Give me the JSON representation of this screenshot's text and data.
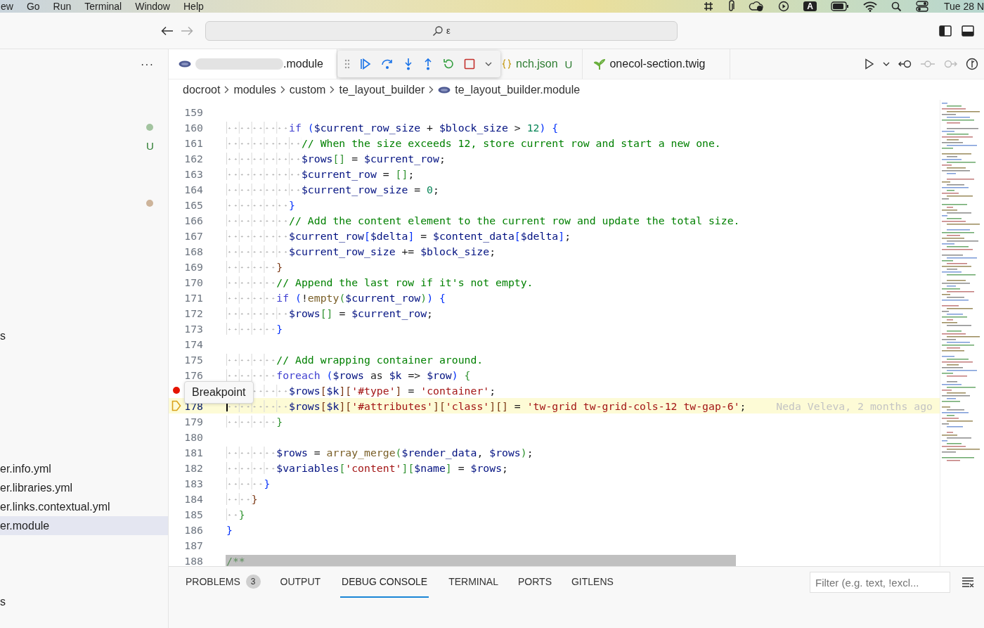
{
  "menu_bar": {
    "items": [
      "ew",
      "Go",
      "Run",
      "Terminal",
      "Window",
      "Help"
    ],
    "input_source": "A",
    "clock": "Tue 28 N"
  },
  "title_bar": {
    "search_text": "ε"
  },
  "sidebar": {
    "more": "···",
    "items": [
      {
        "kind": "blank"
      },
      {
        "kind": "blank"
      },
      {
        "kind": "dot",
        "color": "#a3c4a0"
      },
      {
        "kind": "badge",
        "badge": "U"
      },
      {
        "kind": "blank"
      },
      {
        "kind": "blank"
      },
      {
        "kind": "dot",
        "color": "#cdb49a"
      },
      {
        "kind": "blank"
      },
      {
        "kind": "blank"
      },
      {
        "kind": "blank"
      },
      {
        "kind": "blank"
      },
      {
        "kind": "blank"
      },
      {
        "kind": "blank"
      },
      {
        "kind": "file",
        "label": "s",
        "selected": false
      },
      {
        "kind": "blank"
      },
      {
        "kind": "blank"
      },
      {
        "kind": "blank"
      },
      {
        "kind": "blank"
      },
      {
        "kind": "blank"
      },
      {
        "kind": "blank"
      },
      {
        "kind": "file",
        "label": "er.info.yml",
        "selected": false
      },
      {
        "kind": "file",
        "label": "er.libraries.yml",
        "selected": false
      },
      {
        "kind": "file",
        "label": "er.links.contextual.yml",
        "selected": false
      },
      {
        "kind": "file",
        "label": "er.module",
        "selected": true
      },
      {
        "kind": "blank"
      },
      {
        "kind": "blank"
      },
      {
        "kind": "blank"
      },
      {
        "kind": "file",
        "label": "s",
        "selected": false
      }
    ]
  },
  "tabs": [
    {
      "kind": "php",
      "label": ".module",
      "selected": true,
      "redacted": true
    },
    {
      "kind": "json",
      "label": "nch.json",
      "badge": "U",
      "selected": false,
      "redacted": false
    },
    {
      "kind": "twig",
      "label": "onecol-section.twig",
      "selected": false,
      "redacted": false
    }
  ],
  "breadcrumbs": [
    "docroot",
    "modules",
    "custom",
    "te_layout_builder",
    "te_layout_builder.module"
  ],
  "tooltip": "Breakpoint",
  "code_lines": [
    {
      "number": "159"
    },
    {
      "number": "160",
      "tokens": [
        {
          "kind": "kw",
          "text": "          if "
        },
        {
          "kind": "b1",
          "text": "("
        },
        {
          "kind": "var",
          "text": "$current_row_size"
        },
        {
          "kind": "op",
          "text": " + "
        },
        {
          "kind": "var",
          "text": "$block_size"
        },
        {
          "kind": "op",
          "text": " > "
        },
        {
          "kind": "num",
          "text": "12"
        },
        {
          "kind": "b1",
          "text": ") {"
        }
      ]
    },
    {
      "number": "161",
      "tokens": [
        {
          "kind": "cmt",
          "text": "            // When the size exceeds 12, store current row and start a new one."
        }
      ]
    },
    {
      "number": "162",
      "tokens": [
        {
          "kind": "var",
          "text": "            $rows"
        },
        {
          "kind": "b2",
          "text": "[]"
        },
        {
          "kind": "op",
          "text": " = "
        },
        {
          "kind": "var",
          "text": "$current_row"
        },
        {
          "kind": "op",
          "text": ";"
        }
      ]
    },
    {
      "number": "163",
      "tokens": [
        {
          "kind": "var",
          "text": "            $current_row"
        },
        {
          "kind": "op",
          "text": " = "
        },
        {
          "kind": "b2",
          "text": "[]"
        },
        {
          "kind": "op",
          "text": ";"
        }
      ]
    },
    {
      "number": "164",
      "tokens": [
        {
          "kind": "var",
          "text": "            $current_row_size"
        },
        {
          "kind": "op",
          "text": " = "
        },
        {
          "kind": "num",
          "text": "0"
        },
        {
          "kind": "op",
          "text": ";"
        }
      ]
    },
    {
      "number": "165",
      "tokens": [
        {
          "kind": "b1",
          "text": "          }"
        }
      ]
    },
    {
      "number": "166",
      "tokens": [
        {
          "kind": "cmt",
          "text": "          // Add the content element to the current row and update the total size."
        }
      ]
    },
    {
      "number": "167",
      "tokens": [
        {
          "kind": "var",
          "text": "          $current_row"
        },
        {
          "kind": "b1",
          "text": "["
        },
        {
          "kind": "var",
          "text": "$delta"
        },
        {
          "kind": "b1",
          "text": "]"
        },
        {
          "kind": "op",
          "text": " = "
        },
        {
          "kind": "var",
          "text": "$content_data"
        },
        {
          "kind": "b1",
          "text": "["
        },
        {
          "kind": "var",
          "text": "$delta"
        },
        {
          "kind": "b1",
          "text": "]"
        },
        {
          "kind": "op",
          "text": ";"
        }
      ]
    },
    {
      "number": "168",
      "tokens": [
        {
          "kind": "var",
          "text": "          $current_row_size"
        },
        {
          "kind": "op",
          "text": " += "
        },
        {
          "kind": "var",
          "text": "$block_size"
        },
        {
          "kind": "op",
          "text": ";"
        }
      ]
    },
    {
      "number": "169",
      "tokens": [
        {
          "kind": "b3",
          "text": "        }"
        }
      ]
    },
    {
      "number": "170",
      "tokens": [
        {
          "kind": "cmt",
          "text": "        // Append the last row if it's not empty."
        }
      ]
    },
    {
      "number": "171",
      "tokens": [
        {
          "kind": "kw",
          "text": "        if "
        },
        {
          "kind": "b1",
          "text": "("
        },
        {
          "kind": "op",
          "text": "!"
        },
        {
          "kind": "fn",
          "text": "empty"
        },
        {
          "kind": "b2",
          "text": "("
        },
        {
          "kind": "var",
          "text": "$current_row"
        },
        {
          "kind": "b2",
          "text": ")"
        },
        {
          "kind": "b1",
          "text": ") {"
        }
      ]
    },
    {
      "number": "172",
      "tokens": [
        {
          "kind": "var",
          "text": "          $rows"
        },
        {
          "kind": "b2",
          "text": "[]"
        },
        {
          "kind": "op",
          "text": " = "
        },
        {
          "kind": "var",
          "text": "$current_row"
        },
        {
          "kind": "op",
          "text": ";"
        }
      ]
    },
    {
      "number": "173",
      "tokens": [
        {
          "kind": "b1",
          "text": "        }"
        }
      ]
    },
    {
      "number": "174"
    },
    {
      "number": "175",
      "tokens": [
        {
          "kind": "cmt",
          "text": "        // Add wrapping container around."
        }
      ]
    },
    {
      "number": "176",
      "tokens": [
        {
          "kind": "kw",
          "text": "        foreach "
        },
        {
          "kind": "b1",
          "text": "("
        },
        {
          "kind": "var",
          "text": "$rows"
        },
        {
          "kind": "op",
          "text": " as "
        },
        {
          "kind": "var",
          "text": "$k"
        },
        {
          "kind": "op",
          "text": " => "
        },
        {
          "kind": "var",
          "text": "$row"
        },
        {
          "kind": "b1",
          "text": ")"
        },
        {
          "kind": "b2",
          "text": " {"
        }
      ]
    },
    {
      "breakpoint": true,
      "current": false,
      "tokens": [
        {
          "kind": "var",
          "text": "          $rows"
        },
        {
          "kind": "b3",
          "text": "["
        },
        {
          "kind": "var",
          "text": "$k"
        },
        {
          "kind": "b3",
          "text": "]["
        },
        {
          "kind": "str",
          "text": "'#type'"
        },
        {
          "kind": "b3",
          "text": "]"
        },
        {
          "kind": "op",
          "text": " = "
        },
        {
          "kind": "str",
          "text": "'container'"
        },
        {
          "kind": "op",
          "text": ";"
        }
      ]
    },
    {
      "number": "178",
      "breakpoint": false,
      "current": true,
      "blame": "Neda Veleva, 2 months ago",
      "tokens": [
        {
          "kind": "var",
          "text": "          $rows"
        },
        {
          "kind": "b3",
          "text": "["
        },
        {
          "kind": "var",
          "text": "$k"
        },
        {
          "kind": "b3",
          "text": "]["
        },
        {
          "kind": "str",
          "text": "'#attributes'"
        },
        {
          "kind": "b3",
          "text": "]["
        },
        {
          "kind": "str",
          "text": "'class'"
        },
        {
          "kind": "b3",
          "text": "][]"
        },
        {
          "kind": "op",
          "text": " = "
        },
        {
          "kind": "str",
          "text": "'tw-grid tw-grid-cols-12 tw-gap-6'"
        },
        {
          "kind": "op",
          "text": ";"
        }
      ]
    },
    {
      "number": "179",
      "tokens": [
        {
          "kind": "b2",
          "text": "        }"
        }
      ]
    },
    {
      "number": "180"
    },
    {
      "number": "181",
      "tokens": [
        {
          "kind": "var",
          "text": "        $rows"
        },
        {
          "kind": "op",
          "text": " = "
        },
        {
          "kind": "fn",
          "text": "array_merge"
        },
        {
          "kind": "b2",
          "text": "("
        },
        {
          "kind": "var",
          "text": "$render_data"
        },
        {
          "kind": "op",
          "text": ", "
        },
        {
          "kind": "var",
          "text": "$rows"
        },
        {
          "kind": "b2",
          "text": ")"
        },
        {
          "kind": "op",
          "text": ";"
        }
      ]
    },
    {
      "number": "182",
      "tokens": [
        {
          "kind": "var",
          "text": "        $variables"
        },
        {
          "kind": "b2",
          "text": "["
        },
        {
          "kind": "str",
          "text": "'content'"
        },
        {
          "kind": "b2",
          "text": "]["
        },
        {
          "kind": "var",
          "text": "$name"
        },
        {
          "kind": "b2",
          "text": "]"
        },
        {
          "kind": "op",
          "text": " = "
        },
        {
          "kind": "var",
          "text": "$rows"
        },
        {
          "kind": "op",
          "text": ";"
        }
      ]
    },
    {
      "number": "183",
      "tokens": [
        {
          "kind": "b1",
          "text": "      }"
        }
      ]
    },
    {
      "number": "184",
      "tokens": [
        {
          "kind": "b3",
          "text": "    }"
        }
      ]
    },
    {
      "number": "185",
      "tokens": [
        {
          "kind": "b2",
          "text": "  }"
        }
      ]
    },
    {
      "number": "186",
      "tokens": [
        {
          "kind": "b1",
          "text": "}"
        }
      ]
    },
    {
      "number": "187"
    },
    {
      "number": "188",
      "tokens": [
        {
          "kind": "cmt",
          "text": "/**"
        }
      ]
    }
  ],
  "panel": {
    "tabs": [
      {
        "label": "PROBLEMS",
        "badge": "3",
        "selected": false
      },
      {
        "label": "OUTPUT",
        "selected": false
      },
      {
        "label": "DEBUG CONSOLE",
        "selected": true
      },
      {
        "label": "TERMINAL",
        "selected": false
      },
      {
        "label": "PORTS",
        "selected": false
      },
      {
        "label": "GITLENS",
        "selected": false
      }
    ],
    "filter_placeholder": "Filter (e.g. text, !excl..."
  }
}
